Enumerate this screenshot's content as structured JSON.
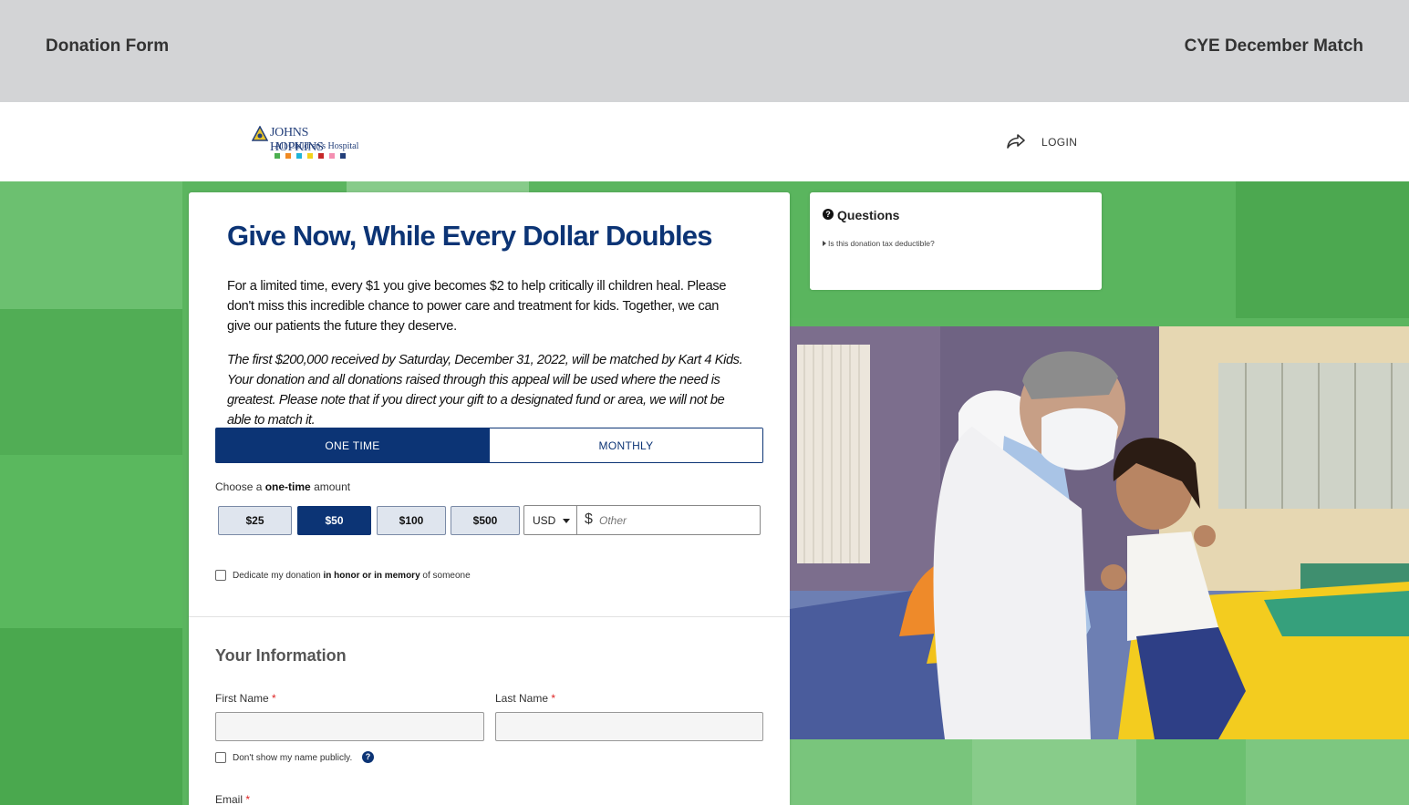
{
  "topbar": {
    "left_title": "Donation Form",
    "right_title": "CYE December Match"
  },
  "header": {
    "logo_line1": "JOHNS HOPKINS",
    "logo_line2": "All Children's Hospital",
    "login_label": "LOGIN"
  },
  "form": {
    "headline": "Give Now, While Every Dollar Doubles",
    "paragraph": "For a limited time, every $1 you give becomes $2 to help critically ill children heal. Please don't miss this incredible chance to power care and treatment for kids. Together, we can give our patients the future they deserve.",
    "match_note": "The first $200,000 received by Saturday, December 31, 2022, will be matched by Kart 4 Kids. Your donation and all donations raised through this appeal will be used where the need is greatest. Please note that if you direct your gift to a designated fund or area, we will not be able to match it.",
    "frequency": {
      "one_time": "ONE TIME",
      "monthly": "MONTHLY"
    },
    "choose_prefix": "Choose a",
    "choose_bold": "one-time",
    "choose_suffix": "amount",
    "amounts": [
      "$25",
      "$50",
      "$100",
      "$500"
    ],
    "selected_amount": "$50",
    "currency": "USD",
    "currency_symbol": "$",
    "other_placeholder": "Other",
    "dedicate_prefix": "Dedicate my donation",
    "dedicate_bold": "in honor or in memory",
    "dedicate_suffix": "of someone",
    "your_info_title": "Your Information",
    "first_name_label": "First Name",
    "last_name_label": "Last Name",
    "required_mark": "*",
    "anon_label": "Don't show my name publicly.",
    "email_label": "Email"
  },
  "questions": {
    "title": "Questions",
    "items": [
      "Is this donation tax deductible?"
    ]
  },
  "colors": {
    "brand_navy": "#0c3475",
    "background_green": "#5bb55f",
    "required_red": "#dd2222"
  }
}
